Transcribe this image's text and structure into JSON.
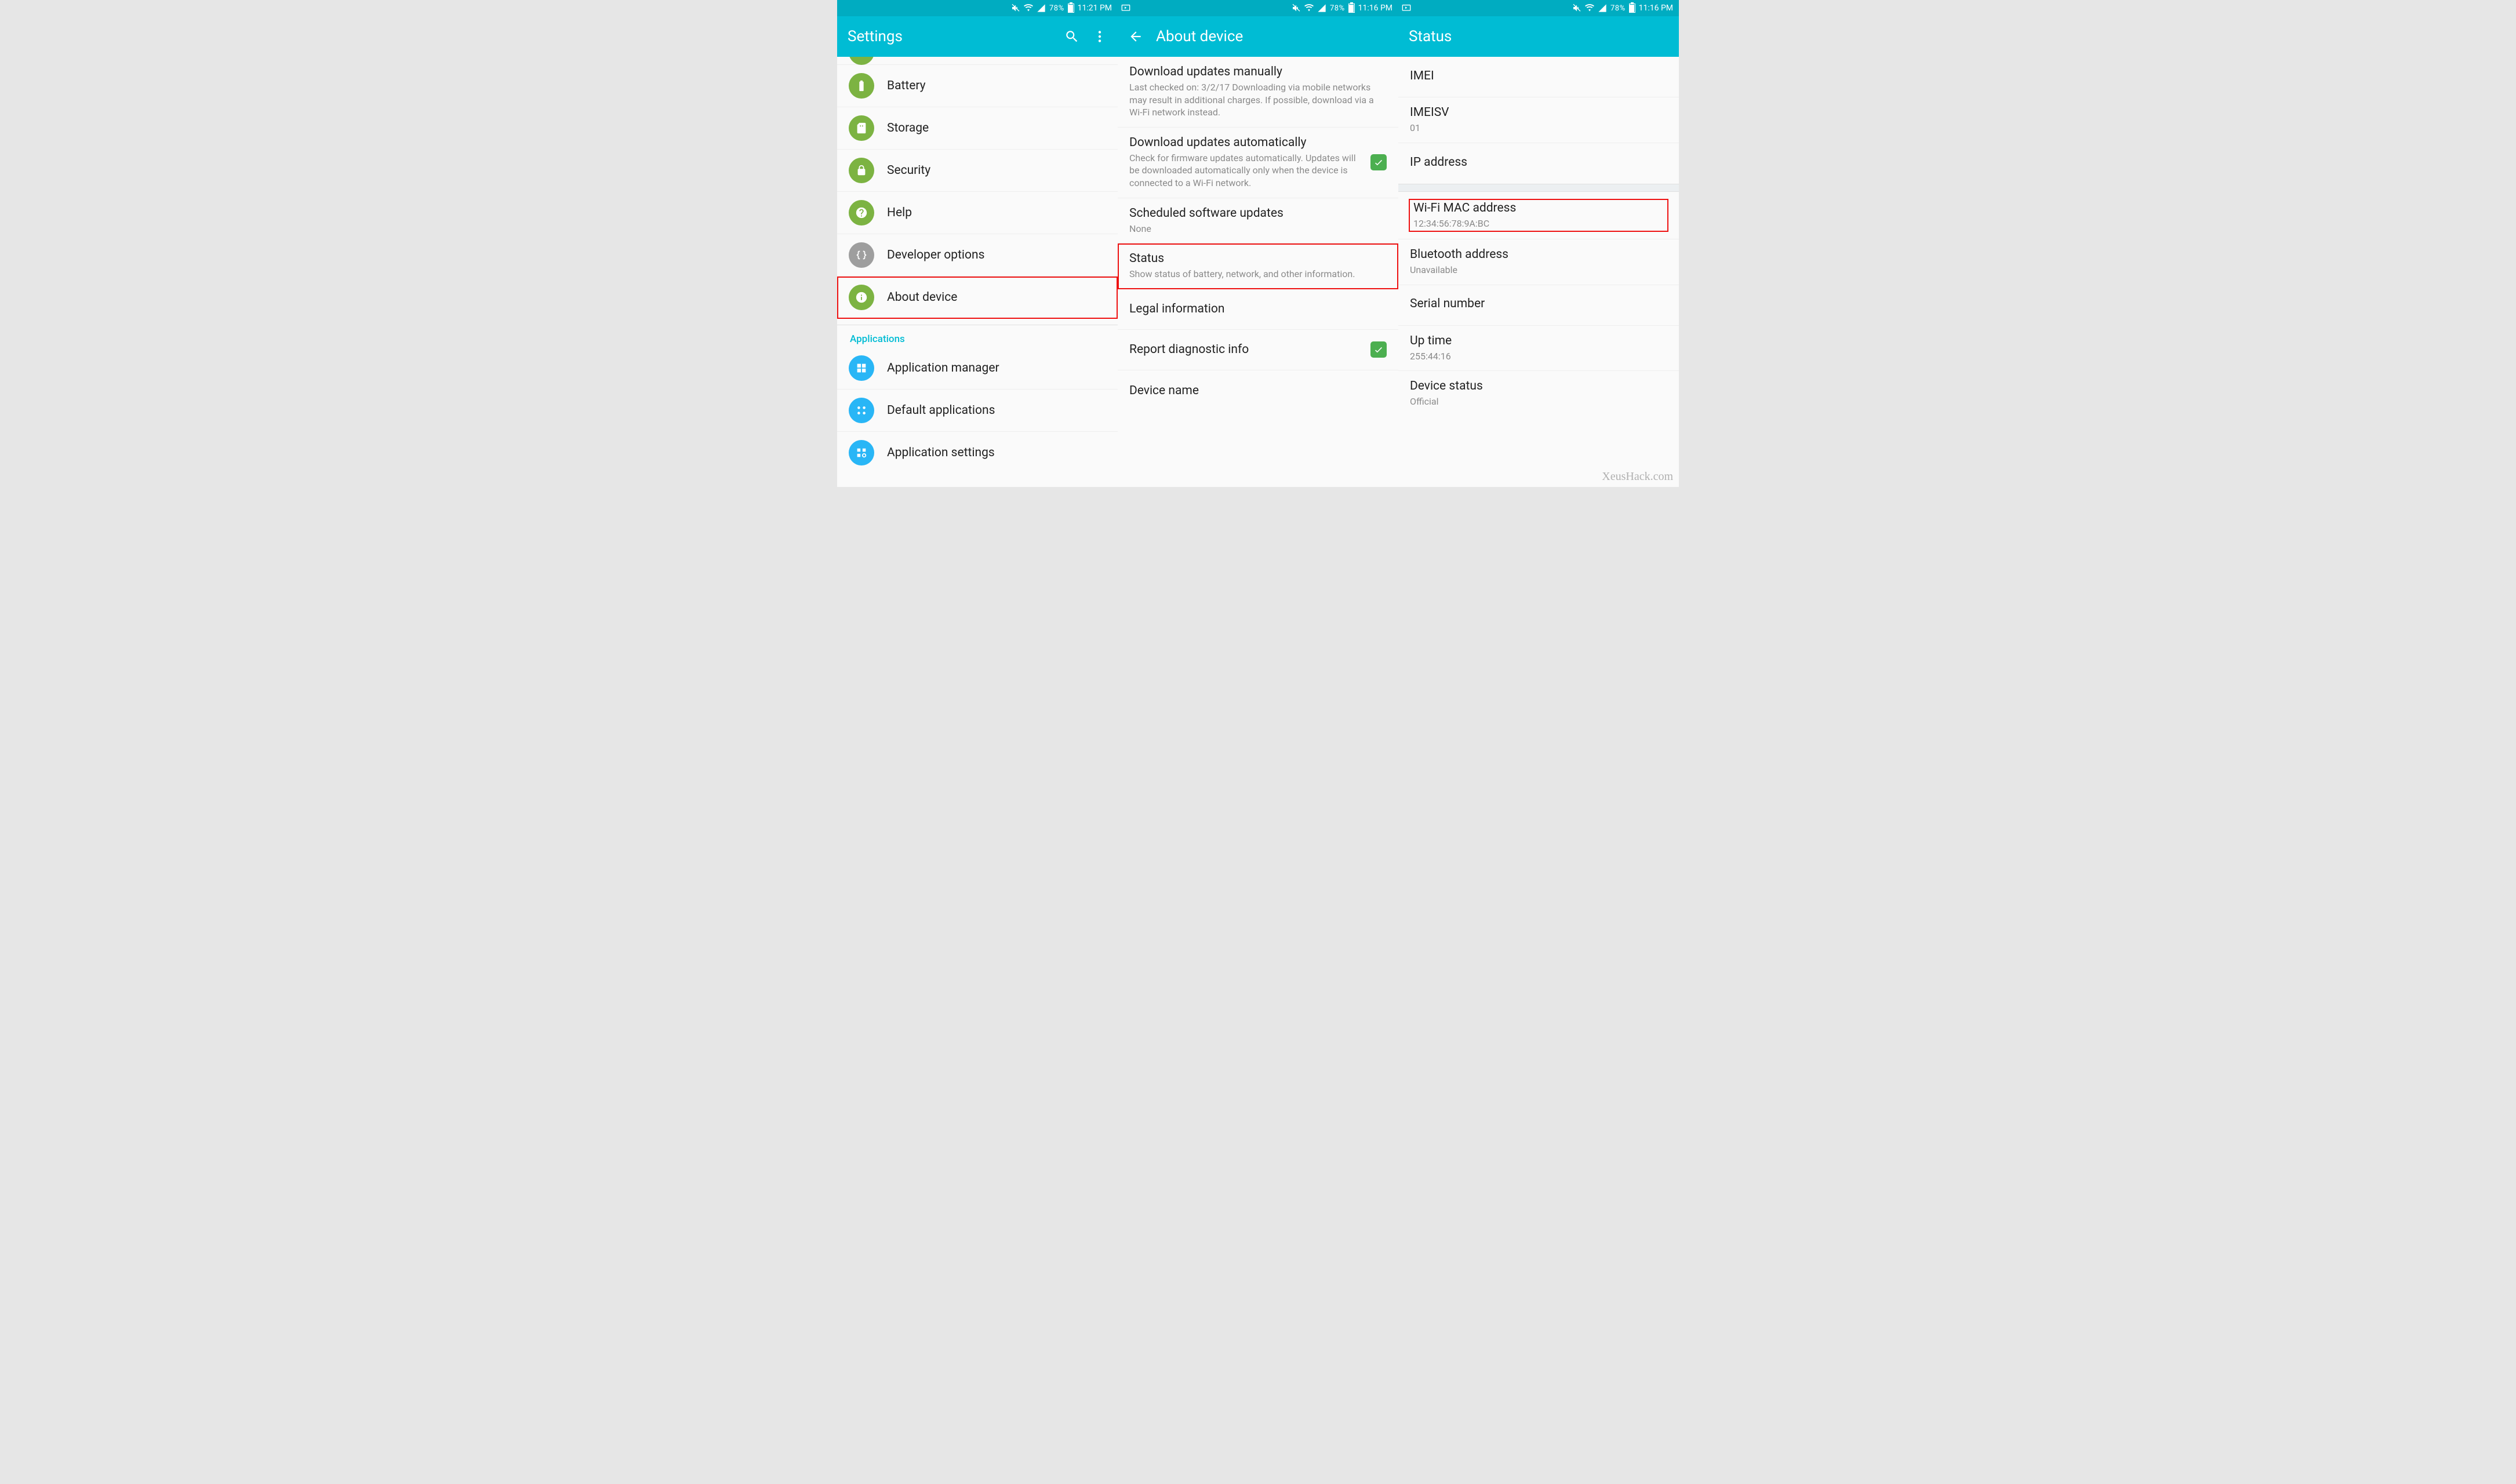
{
  "colors": {
    "teal": "#00bcd4",
    "tealDark": "#00acc1",
    "green": "#7cb342",
    "blue": "#29b6f6",
    "grey": "#9e9e9e",
    "highlight": "#e11"
  },
  "watermark": "XeusHack.com",
  "panes": {
    "p1": {
      "status": {
        "leftIcons": [],
        "battery": "78%",
        "time": "11:21 PM"
      },
      "appbar": {
        "title": "Settings",
        "hasSearch": true,
        "hasMore": true
      },
      "sectionApps": "Applications",
      "items": {
        "battery": "Battery",
        "storage": "Storage",
        "security": "Security",
        "help": "Help",
        "dev": "Developer options",
        "about": "About device",
        "appmgr": "Application manager",
        "defapps": "Default applications",
        "appset": "Application settings"
      }
    },
    "p2": {
      "status": {
        "leftIcons": [
          "screenshot"
        ],
        "battery": "78%",
        "time": "11:16 PM"
      },
      "appbar": {
        "title": "About device",
        "hasBack": true
      },
      "items": {
        "dlman": {
          "title": "Download updates manually",
          "sub": "Last checked on: 3/2/17\nDownloading via mobile networks may result in additional charges. If possible, download via a Wi-Fi network instead."
        },
        "dlauto": {
          "title": "Download updates automatically",
          "sub": "Check for firmware updates automatically. Updates will be downloaded automatically only when the device is connected to a Wi-Fi network.",
          "checked": true
        },
        "sched": {
          "title": "Scheduled software updates",
          "sub": "None"
        },
        "status": {
          "title": "Status",
          "sub": "Show status of battery, network, and other information."
        },
        "legal": {
          "title": "Legal information"
        },
        "diag": {
          "title": "Report diagnostic info",
          "checked": true
        },
        "devname": {
          "title": "Device name"
        }
      }
    },
    "p3": {
      "status": {
        "leftIcons": [
          "screenshot"
        ],
        "battery": "78%",
        "time": "11:16 PM"
      },
      "appbar": {
        "title": "Status"
      },
      "items": {
        "imei": {
          "title": "IMEI",
          "sub": ""
        },
        "imeisv": {
          "title": "IMEISV",
          "sub": "01"
        },
        "ip": {
          "title": "IP address",
          "sub": ""
        },
        "wifimac": {
          "title": "Wi-Fi MAC address",
          "sub": "12:34:56:78:9A:BC"
        },
        "bt": {
          "title": "Bluetooth address",
          "sub": "Unavailable"
        },
        "serial": {
          "title": "Serial number",
          "sub": ""
        },
        "uptime": {
          "title": "Up time",
          "sub": "255:44:16"
        },
        "devstat": {
          "title": "Device status",
          "sub": "Official"
        }
      }
    }
  }
}
